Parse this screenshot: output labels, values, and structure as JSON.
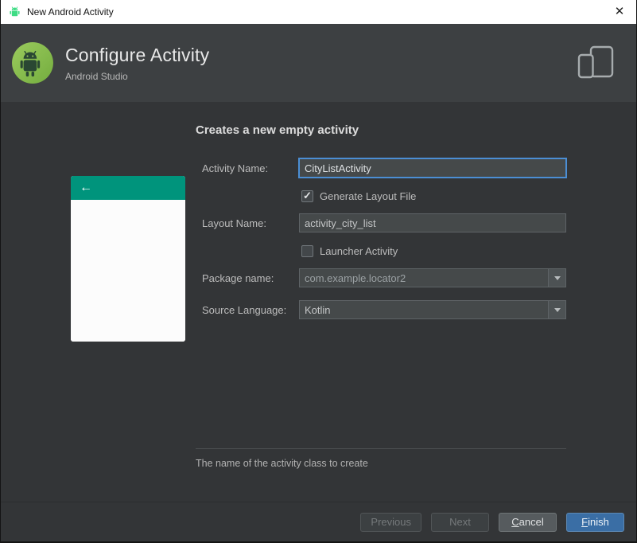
{
  "window": {
    "title": "New Android Activity",
    "close_glyph": "✕"
  },
  "header": {
    "title": "Configure Activity",
    "subtitle": "Android Studio"
  },
  "preview": {
    "back_arrow_glyph": "←"
  },
  "form": {
    "heading": "Creates a new empty activity",
    "fields": {
      "activity_name": {
        "label": "Activity Name:",
        "value": "CityListActivity"
      },
      "generate_layout_file": {
        "label": "Generate Layout File",
        "checked": true
      },
      "layout_name": {
        "label": "Layout Name:",
        "value": "activity_city_list"
      },
      "launcher_activity": {
        "label": "Launcher Activity",
        "checked": false
      },
      "package_name": {
        "label": "Package name:",
        "value": "com.example.locator2"
      },
      "source_language": {
        "label": "Source Language:",
        "value": "Kotlin"
      }
    },
    "helper_text": "The name of the activity class to create"
  },
  "footer": {
    "previous": {
      "label": "Previous",
      "disabled": true
    },
    "next": {
      "label": "Next",
      "disabled": true
    },
    "cancel": {
      "mnemonic": "C",
      "rest": "ancel"
    },
    "finish": {
      "mnemonic": "F",
      "rest": "inish"
    }
  },
  "colors": {
    "appbar_teal": "#00947C",
    "focus_blue": "#4B8ED4",
    "finish_blue": "#3A6EA5",
    "android_green": "#3DDC84"
  }
}
